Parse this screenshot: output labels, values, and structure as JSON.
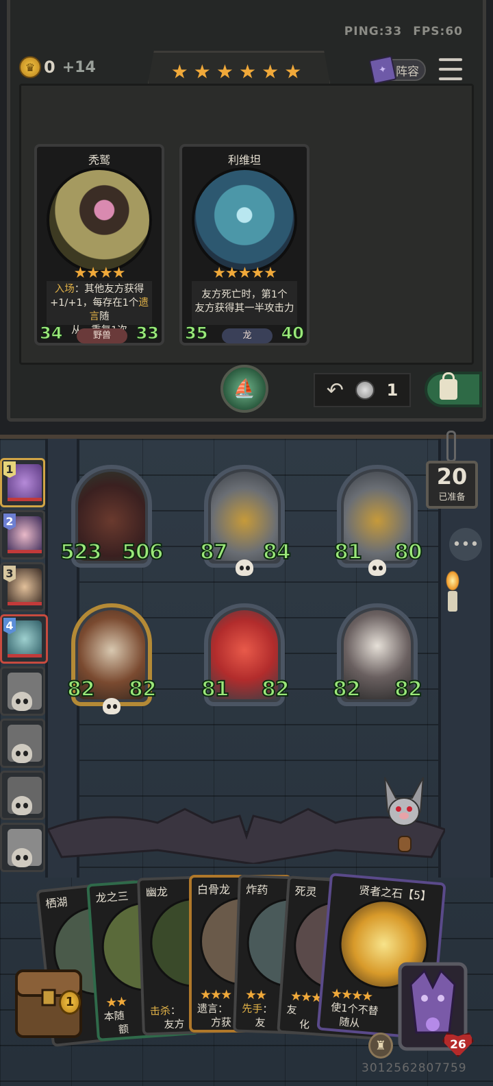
{
  "network": {
    "ping": "PING:33",
    "fps": "FPS:60"
  },
  "gold": {
    "amount": "0",
    "income": "+14"
  },
  "tavern_tier_stars": "★★★★★★",
  "lineup_button": "阵容",
  "shop_cards": [
    {
      "name": "秃鹫",
      "stars": "★★★★",
      "text_parts": [
        "入场",
        "：其他友方获得",
        "+1/+1，每存在1个",
        "遗言",
        "随",
        "从，重复1次"
      ],
      "attack": "34",
      "health": "33",
      "tribe": "野兽"
    },
    {
      "name": "利维坦",
      "stars": "★★★★★",
      "text_line1": "友方死亡时，第1个",
      "text_line2": "友方获得其一半攻击力",
      "attack": "35",
      "health": "40",
      "tribe": "龙"
    }
  ],
  "undo": {
    "count": "1"
  },
  "ready": {
    "count": "20",
    "label": "已准备"
  },
  "players": [
    {
      "rank": "1"
    },
    {
      "rank": "2"
    },
    {
      "rank": "3"
    },
    {
      "rank": "4"
    }
  ],
  "board_minions": [
    {
      "attack": "523",
      "health": "506"
    },
    {
      "attack": "87",
      "health": "84"
    },
    {
      "attack": "81",
      "health": "80"
    },
    {
      "attack": "82",
      "health": "82"
    },
    {
      "attack": "81",
      "health": "82"
    },
    {
      "attack": "82",
      "health": "82"
    }
  ],
  "hand_cards": [
    {
      "name": "栖湖",
      "stars": "",
      "text": "",
      "text2": ""
    },
    {
      "name": "龙之三",
      "stars": "★★",
      "text": "本随",
      "text2": "额"
    },
    {
      "name": "幽龙",
      "stars": "",
      "text_kw": "击杀",
      "text": "：",
      "text2": "友方"
    },
    {
      "name": "白骨龙",
      "stars": "★★★",
      "text": "遗言：",
      "text2": "方获"
    },
    {
      "name": "炸药",
      "stars": "★★",
      "text_kw": "先手",
      "text": "：",
      "text2": "友"
    },
    {
      "name": "死灵",
      "stars": "★★★",
      "text": "友",
      "text2": "化"
    },
    {
      "name": "贤者之石【5】",
      "stars": "★★★★",
      "text": "使1个不替",
      "text2": "随从"
    }
  ],
  "chest_badge": "1",
  "hero_health": "26",
  "user_id": "3012562807759",
  "colors": {
    "accent_gold": "#f0a93a",
    "stat_green": "#9be87a",
    "lock_green": "#2e6a46"
  }
}
